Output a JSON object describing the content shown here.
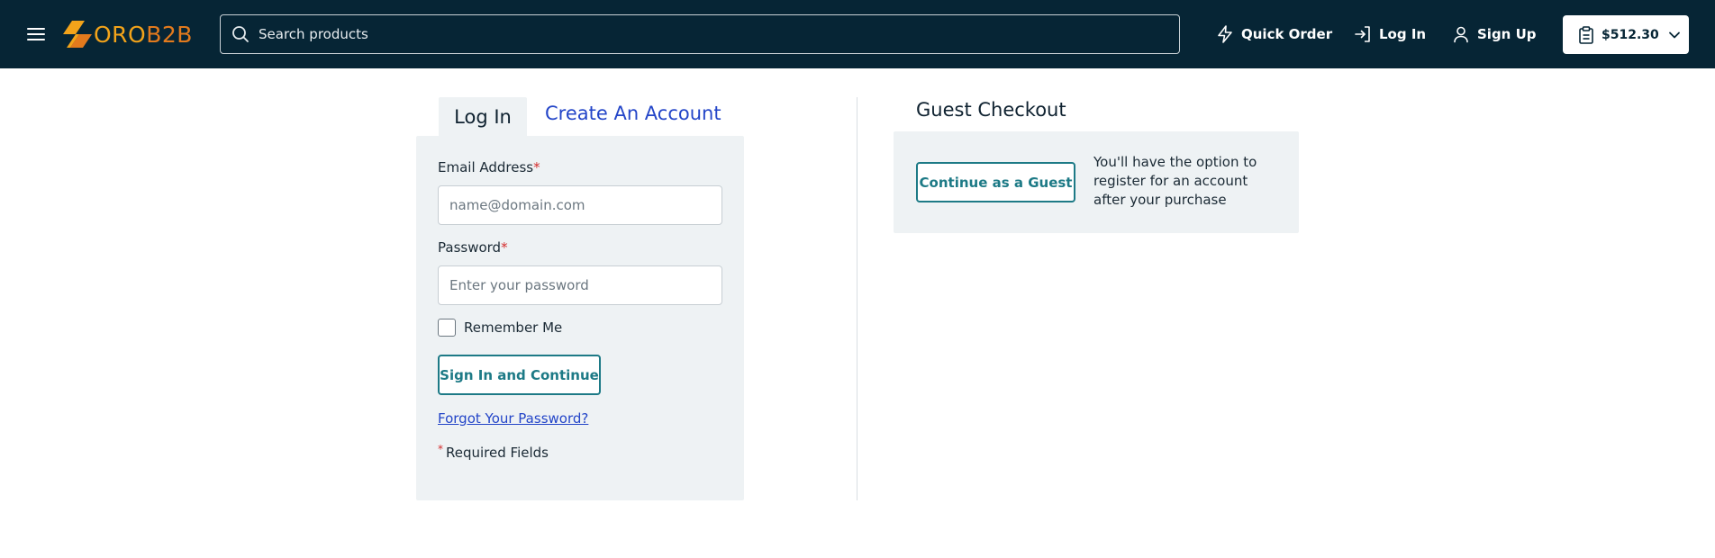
{
  "header": {
    "logo": {
      "part1": "ORO",
      "part2": "B2B"
    },
    "search_placeholder": "Search products",
    "quick_order_label": "Quick Order",
    "login_label": "Log In",
    "signup_label": "Sign Up",
    "cart_total": "$512.30",
    "icons": [
      "menu-icon",
      "search-icon",
      "lightning-icon",
      "login-icon",
      "user-icon",
      "clipboard-icon",
      "chevron-down-icon"
    ]
  },
  "login": {
    "tab_login": "Log In",
    "tab_create": "Create An Account",
    "email_label": "Email Address",
    "email_placeholder": "name@domain.com",
    "password_label": "Password",
    "password_placeholder": "Enter your password",
    "required_mark": "*",
    "remember_label": "Remember Me",
    "signin_button": "Sign In and Continue",
    "forgot_link": "Forgot Your Password?",
    "required_fields": "Required Fields"
  },
  "guest": {
    "title": "Guest Checkout",
    "button": "Continue as a Guest",
    "note": "You'll have the option to register for an account after your purchase"
  },
  "colors": {
    "header_bg": "#062535",
    "accent_teal": "#1d7a86",
    "link_blue": "#2345c8",
    "panel_bg": "#eef2f4",
    "required_red": "#d42d2d",
    "logo_yellow": "#f2a31a",
    "logo_orange": "#e27a1d"
  }
}
